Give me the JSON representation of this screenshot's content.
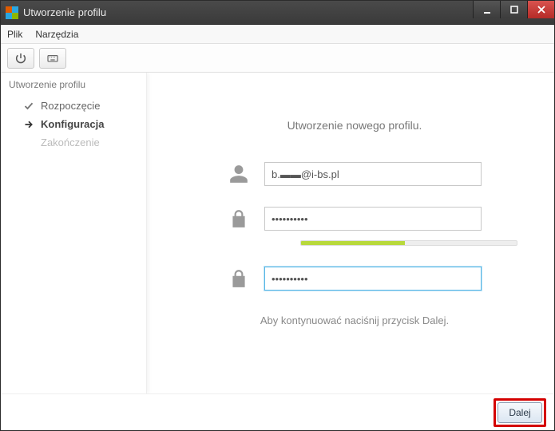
{
  "window": {
    "title": "Utworzenie profilu"
  },
  "menu": {
    "file": "Plik",
    "tools": "Narzędzia"
  },
  "sidebar": {
    "title": "Utworzenie profilu",
    "steps": {
      "start": "Rozpoczęcie",
      "config": "Konfiguracja",
      "finish": "Zakończenie"
    }
  },
  "main": {
    "heading": "Utworzenie nowego profilu.",
    "username": "b.▬▬@i-bs.pl",
    "password": "••••••••••",
    "password_confirm": "••••••••••",
    "hint": "Aby kontynuować naciśnij przycisk Dalej."
  },
  "footer": {
    "next": "Dalej"
  }
}
